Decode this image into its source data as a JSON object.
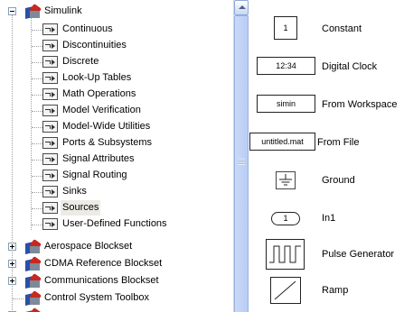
{
  "tree": {
    "root": {
      "label": "Simulink",
      "icon": "simulink-library-icon",
      "expanded": true
    },
    "children": [
      {
        "label": "Continuous",
        "icon": "block-subsystem-icon"
      },
      {
        "label": "Discontinuities",
        "icon": "block-subsystem-icon"
      },
      {
        "label": "Discrete",
        "icon": "block-subsystem-icon"
      },
      {
        "label": "Look-Up Tables",
        "icon": "block-subsystem-icon"
      },
      {
        "label": "Math Operations",
        "icon": "block-subsystem-icon"
      },
      {
        "label": "Model Verification",
        "icon": "block-subsystem-icon"
      },
      {
        "label": "Model-Wide Utilities",
        "icon": "block-subsystem-icon"
      },
      {
        "label": "Ports & Subsystems",
        "icon": "block-subsystem-icon"
      },
      {
        "label": "Signal Attributes",
        "icon": "block-subsystem-icon"
      },
      {
        "label": "Signal Routing",
        "icon": "block-subsystem-icon"
      },
      {
        "label": "Sinks",
        "icon": "block-subsystem-icon"
      },
      {
        "label": "Sources",
        "icon": "block-subsystem-icon",
        "selected": true
      },
      {
        "label": "User-Defined Functions",
        "icon": "block-subsystem-icon"
      }
    ],
    "other_libraries": [
      {
        "label": "Aerospace Blockset",
        "expanded": false,
        "has_expander": true
      },
      {
        "label": "CDMA Reference Blockset",
        "expanded": false,
        "has_expander": true
      },
      {
        "label": "Communications Blockset",
        "expanded": false,
        "has_expander": true
      },
      {
        "label": "Control System Toolbox",
        "expanded": false,
        "has_expander": false
      }
    ]
  },
  "palette": {
    "blocks": [
      {
        "label": "Constant",
        "shape_text": "1",
        "shape": "square"
      },
      {
        "label": "Digital Clock",
        "shape_text": "12:34",
        "shape": "wide"
      },
      {
        "label": "From Workspace",
        "shape_text": "simin",
        "shape": "wide"
      },
      {
        "label": "From File",
        "shape_text": "untitled.mat",
        "shape": "wide"
      },
      {
        "label": "Ground",
        "shape_text": "",
        "shape": "ground"
      },
      {
        "label": "In1",
        "shape_text": "1",
        "shape": "port"
      },
      {
        "label": "Pulse Generator",
        "shape_text": "",
        "shape": "pulse"
      },
      {
        "label": "Ramp",
        "shape_text": "",
        "shape": "ramp"
      }
    ]
  },
  "colors": {
    "selection_text": "#000000",
    "scrollbar_thumb": "#c2d3f7",
    "library_blue": "#2a4fa7",
    "library_red": "#c8281f"
  }
}
